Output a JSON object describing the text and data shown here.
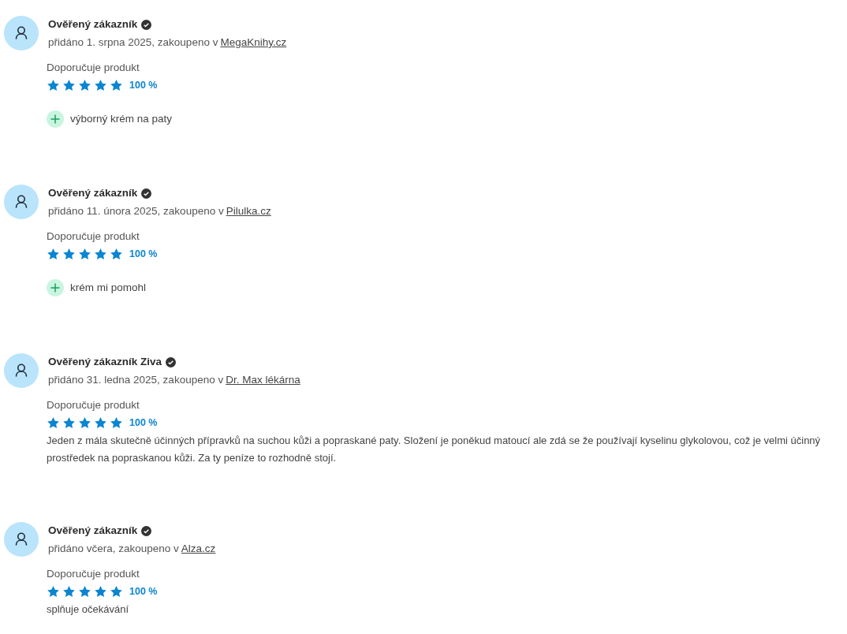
{
  "reviews": [
    {
      "author": "Ověřený zákazník",
      "verified": true,
      "meta": "přidáno 1. srpna 2025, zakoupeno v ",
      "shop": "MegaKnihy.cz",
      "recommendation": "Doporučuje produkt",
      "stars": 5,
      "percent": "100 %",
      "pros": [
        "výborný krém na paty"
      ]
    },
    {
      "author": "Ověřený zákazník",
      "verified": true,
      "meta": "přidáno 11. února 2025, zakoupeno v ",
      "shop": "Pilulka.cz",
      "recommendation": "Doporučuje produkt",
      "stars": 5,
      "percent": "100 %",
      "pros": [
        "krém mi pomohl"
      ]
    },
    {
      "author": "Ověřený zákazník Ziva",
      "verified": true,
      "meta": "přidáno 31. ledna 2025, zakoupeno v ",
      "shop": "Dr. Max lékárna",
      "recommendation": "Doporučuje produkt",
      "stars": 5,
      "percent": "100 %",
      "text": "Jeden z mála skutečně účinných přípravků na suchou kůži a popraskané paty. Složení je poněkud matoucí ale zdá se že používají kyselinu glykolovou, což je velmi účinný prostředek na popraskanou kůži. Za ty peníze to rozhodně stojí."
    },
    {
      "author": "Ověřený zákazník",
      "verified": true,
      "meta": "přidáno včera, zakoupeno v ",
      "shop": "Alza.cz",
      "recommendation": "Doporučuje produkt",
      "stars": 5,
      "percent": "100 %",
      "text": "splňuje očekávání"
    }
  ]
}
